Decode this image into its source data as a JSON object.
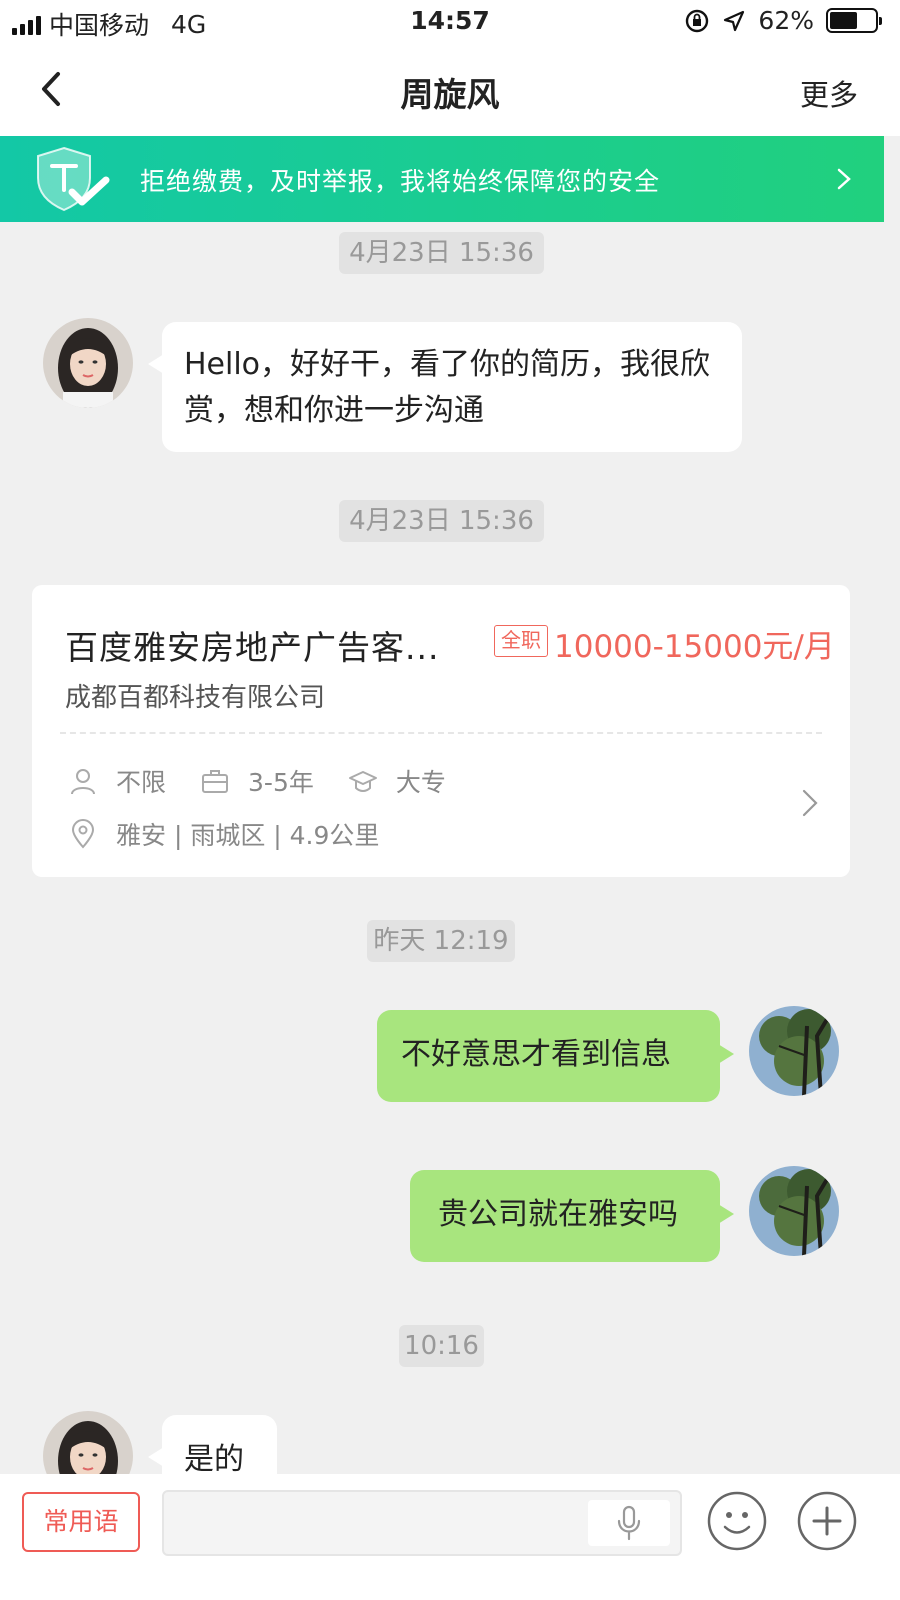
{
  "status_bar": {
    "carrier": "中国移动",
    "network": "4G",
    "time": "14:57",
    "battery": "62%",
    "battery_level": 0.62
  },
  "nav": {
    "title": "周旋风",
    "more": "更多"
  },
  "banner": {
    "text": "拒绝缴费，及时举报，我将始终保障您的安全"
  },
  "messages": {
    "ts1": "4月23日 15:36",
    "msg1": "Hello，好好干，看了你的简历，我很欣赏，想和你进一步沟通",
    "ts2": "4月23日 15:36",
    "ts3": "昨天 12:19",
    "msg2": "不好意思才看到信息",
    "msg3": "贵公司就在雅安吗",
    "ts4": "10:16",
    "msg4": "是的"
  },
  "job_card": {
    "title": "百度雅安房地产广告客...",
    "tag": "全职",
    "salary": "10000-15000元/月",
    "company": "成都百都科技有限公司",
    "headcount": "不限",
    "experience": "3-5年",
    "education": "大专",
    "location": "雅安 | 雨城区 | 4.9公里"
  },
  "input_bar": {
    "phrases": "常用语"
  },
  "colors": {
    "accent_green": "#21d07e",
    "bubble_green": "#a8e57e",
    "salary_red": "#f0675c"
  }
}
